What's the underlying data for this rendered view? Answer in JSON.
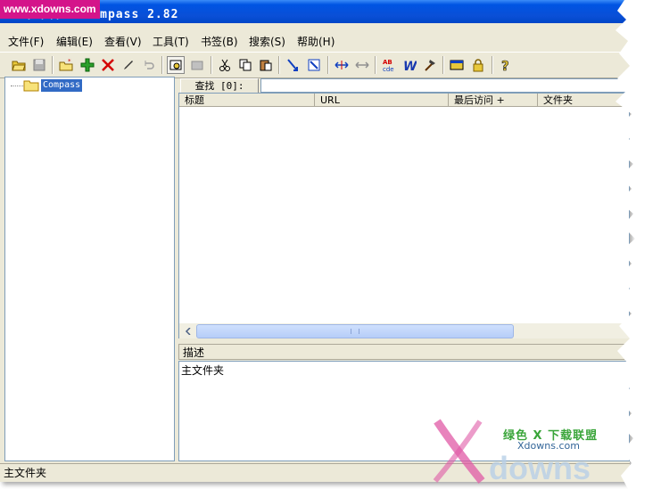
{
  "window": {
    "title": "未命名 - Compass 2.82",
    "watermark": "www.xdowns.com"
  },
  "menubar": {
    "items": [
      "文件(F)",
      "编辑(E)",
      "查看(V)",
      "工具(T)",
      "书签(B)",
      "搜索(S)",
      "帮助(H)"
    ]
  },
  "toolbar": {
    "icons": [
      "open-folder-icon",
      "save-icon",
      "new-folder-icon",
      "add-icon",
      "delete-icon",
      "edit-icon",
      "undo-icon",
      "view-icon",
      "properties-icon",
      "cut-icon",
      "copy-icon",
      "paste-icon",
      "import-icon",
      "export-icon",
      "expand-icon",
      "collapse-icon",
      "spell-check-icon",
      "word-icon",
      "tools-icon",
      "window-icon",
      "lock-icon",
      "help-icon"
    ]
  },
  "tree": {
    "root_label": "Compass"
  },
  "search": {
    "label": "查找 [0]:",
    "value": ""
  },
  "list": {
    "columns": [
      "标题",
      "URL",
      "最后访问 +",
      "文件夹"
    ]
  },
  "description": {
    "header": "描述",
    "text": "主文件夹"
  },
  "statusbar": {
    "text": "主文件夹"
  },
  "logo": {
    "cn": "绿色 X 下载联盟",
    "en": "Xdowns.com"
  },
  "colors": {
    "titlebar": "#0054e3",
    "selection": "#316ac5",
    "watermark": "#d4148a",
    "face": "#ece9d8"
  }
}
